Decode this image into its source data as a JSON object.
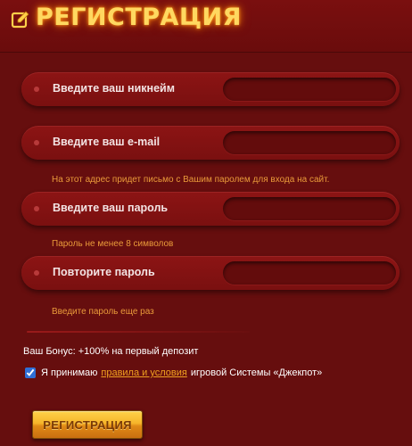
{
  "header": {
    "title": "РЕГИСТРАЦИЯ",
    "icon": "edit-icon",
    "title_color": "#ffd860"
  },
  "form": {
    "fields": [
      {
        "label": "Введите ваш никнейм",
        "value": ""
      },
      {
        "label": "Введите ваш e-mail",
        "value": "",
        "hint": "На этот адрес придет письмо с Вашим паролем для входа на сайт."
      },
      {
        "label": "Введите ваш пароль",
        "value": "",
        "hint": "Пароль не менее 8 символов"
      },
      {
        "label": "Повторите пароль",
        "value": "",
        "hint": "Введите пароль еще раз"
      }
    ],
    "bonus_text": "Ваш Бонус: +100% на первый депозит",
    "agree": {
      "checked": true,
      "prefix": "Я принимаю",
      "link": "правила и условия",
      "suffix": "игровой Системы «Джекпот»"
    },
    "submit_label": "РЕГИСТРАЦИЯ"
  },
  "colors": {
    "background": "#5a0b0b",
    "field": "#8c1414",
    "hint": "#e99a3a",
    "link": "#f0a020",
    "button": "#f6b52a"
  }
}
